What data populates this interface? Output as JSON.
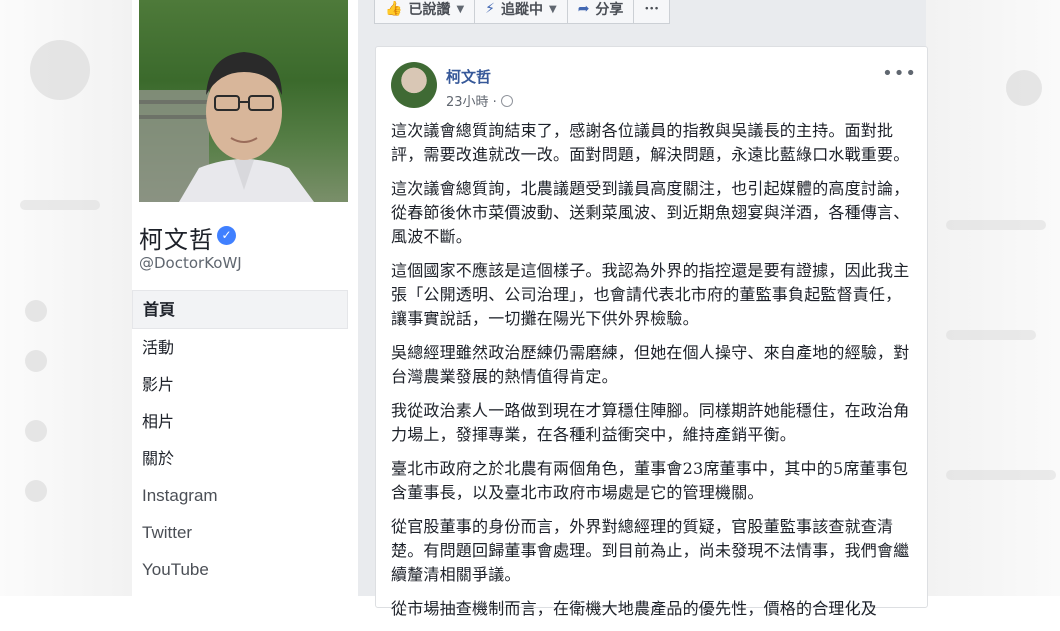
{
  "page": {
    "name": "柯文哲",
    "handle": "@DoctorKoWJ"
  },
  "nav": {
    "items": [
      {
        "label": "首頁",
        "active": true
      },
      {
        "label": "活動"
      },
      {
        "label": "影片"
      },
      {
        "label": "相片"
      },
      {
        "label": "關於"
      },
      {
        "label": "Instagram"
      },
      {
        "label": "Twitter"
      },
      {
        "label": "YouTube"
      }
    ]
  },
  "actions": {
    "liked": "已說讚",
    "following": "追蹤中",
    "share": "分享",
    "more": "···"
  },
  "post": {
    "author": "柯文哲",
    "time": "23小時 ·",
    "more": "•••",
    "paragraphs": [
      "這次議會總質詢結束了，感謝各位議員的指教與吳議長的主持。面對批評，需要改進就改一改。面對問題，解決問題，永遠比藍綠口水戰重要。",
      "這次議會總質詢，北農議題受到議員高度關注，也引起媒體的高度討論，從春節後休市菜價波動、送剩菜風波、到近期魚翅宴與洋酒，各種傳言、風波不斷。",
      "這個國家不應該是這個樣子。我認為外界的指控還是要有證據，因此我主張「公開透明、公司治理」，也會請代表北市府的董監事負起監督責任，讓事實說話，一切攤在陽光下供外界檢驗。",
      "吳總經理雖然政治歷練仍需磨練，但她在個人操守、來自產地的經驗，對台灣農業發展的熱情值得肯定。",
      "我從政治素人一路做到現在才算穩住陣腳。同樣期許她能穩住，在政治角力場上，發揮專業，在各種利益衝突中，維持產銷平衡。",
      "臺北市政府之於北農有兩個角色，董事會23席董事中，其中的5席董事包含董事長，以及臺北市政府市場處是它的管理機關。",
      "從官股董事的身份而言，外界對總經理的質疑，官股董監事該查就查清楚。有問題回歸董事會處理。到目前為止，尚未發現不法情事，我們會繼續釐清相關爭議。",
      "從市場抽查機制而言，在衛機大地農產品的優先性，價格的合理化及"
    ]
  },
  "colors": {
    "link": "#365899",
    "verified": "#4080ff",
    "feed_bg": "#e9ebee"
  },
  "icons": [
    "verified-icon",
    "thumbs-up-icon",
    "rss-icon",
    "share-arrow-icon",
    "globe-icon",
    "more-icon"
  ]
}
